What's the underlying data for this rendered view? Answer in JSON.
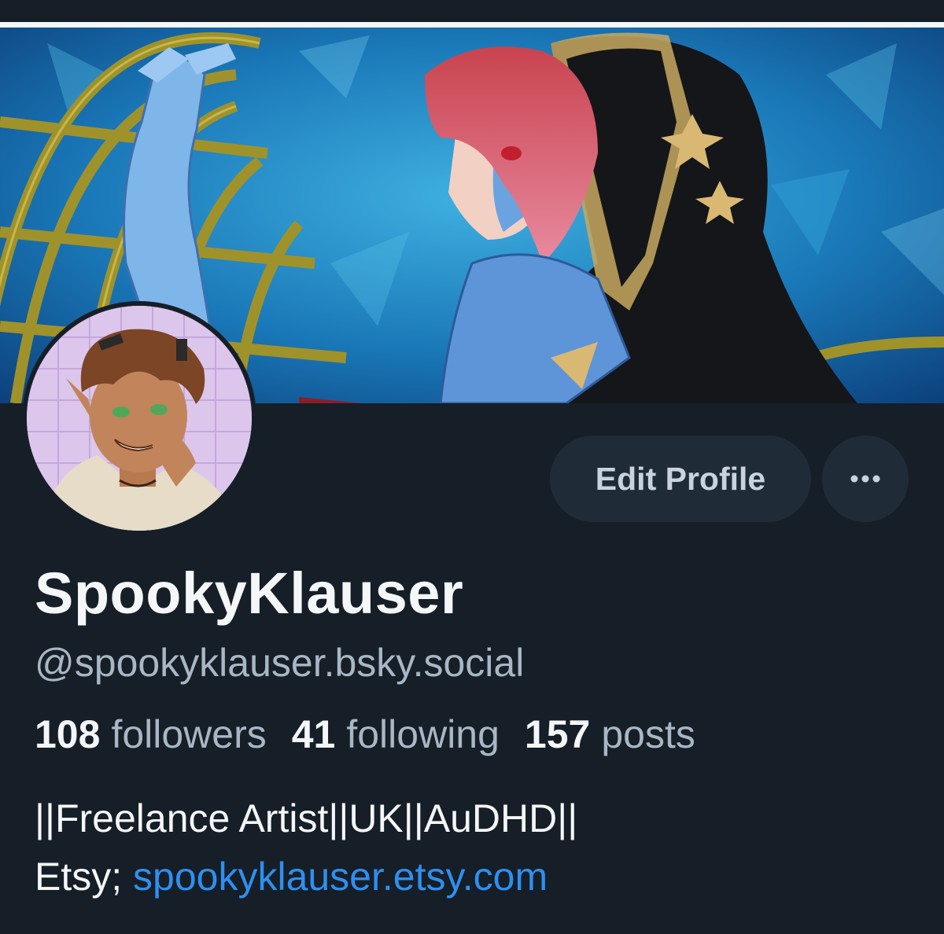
{
  "profile": {
    "display_name": "SpookyKlauser",
    "handle": "@spookyklauser.bsky.social",
    "banner_image": "anime-style illustration banner",
    "avatar_image": "anime-style avatar portrait"
  },
  "actions": {
    "edit_profile_label": "Edit Profile",
    "more_icon": "ellipsis-icon"
  },
  "stats": {
    "followers_count": "108",
    "followers_label": "followers",
    "following_count": "41",
    "following_label": "following",
    "posts_count": "157",
    "posts_label": "posts"
  },
  "bio": {
    "line1": "||Freelance Artist||UK||AuDHD||",
    "line2_prefix": "Etsy; ",
    "link_text": "spookyklauser.etsy.com"
  },
  "colors": {
    "background": "#161e27",
    "button_bg": "#202b38",
    "primary_text": "#f4f6f8",
    "secondary_text": "#a9b6c4",
    "link": "#2e8ff0"
  }
}
